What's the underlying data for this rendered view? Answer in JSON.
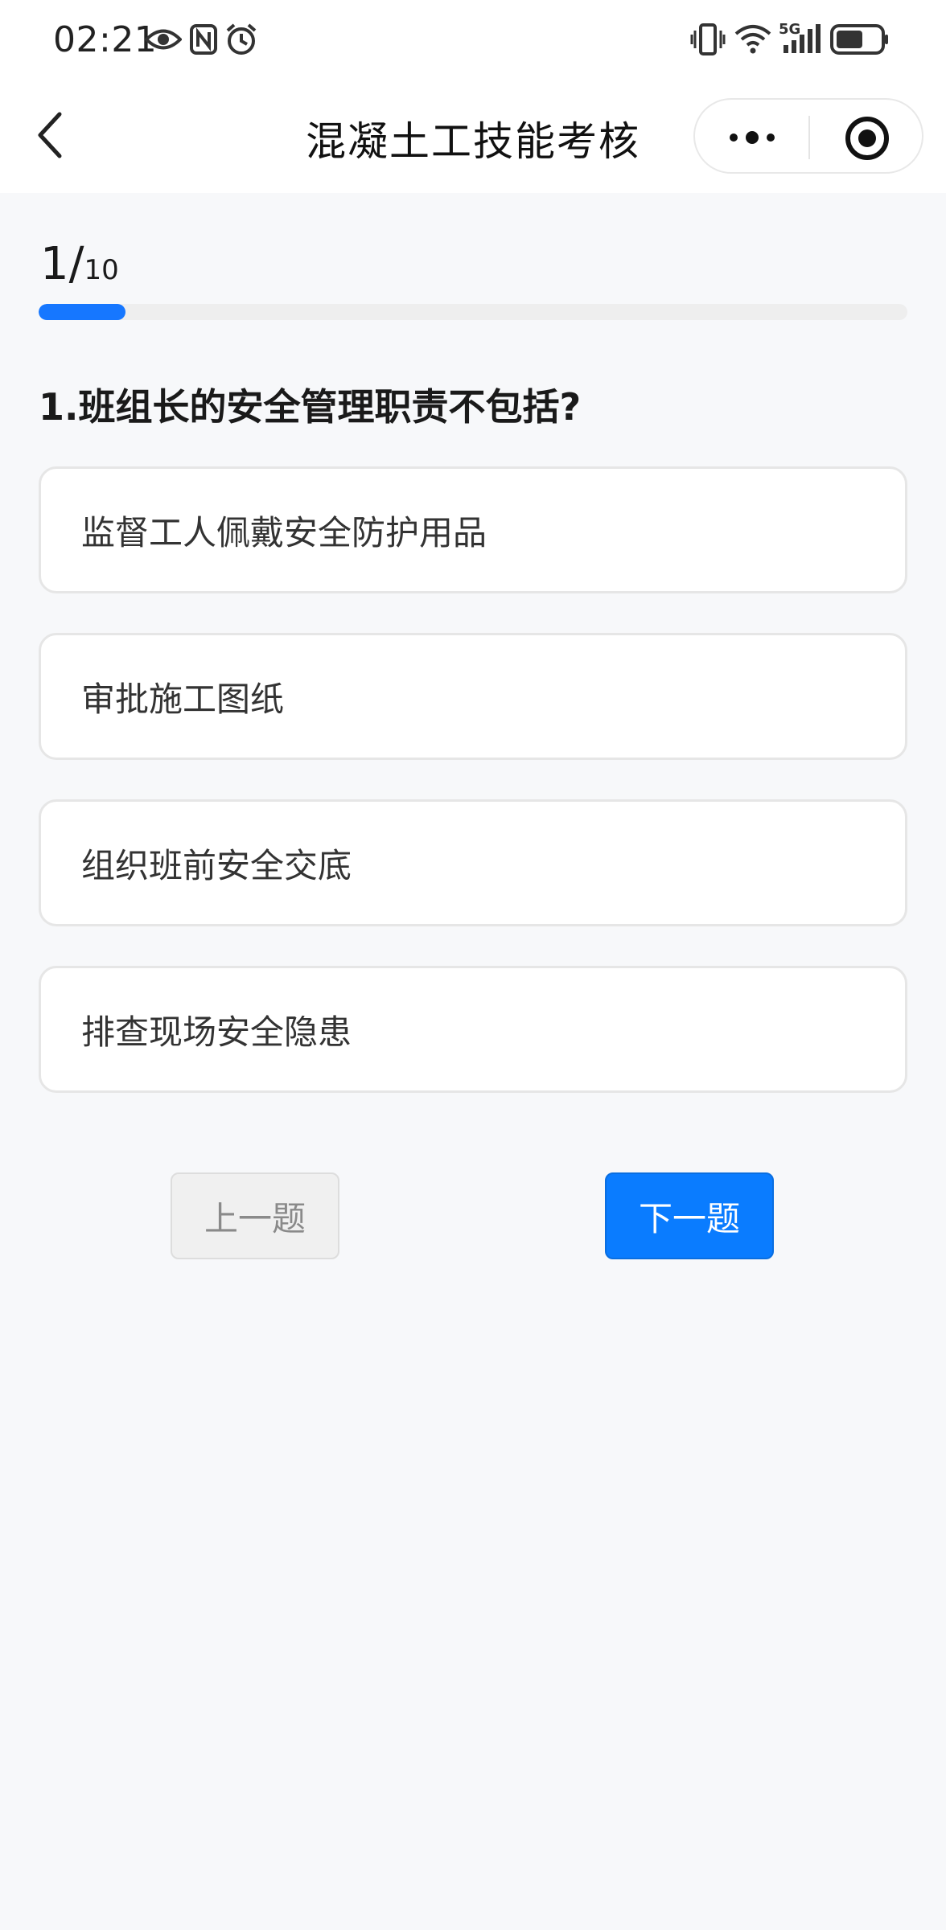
{
  "status_bar": {
    "time": "02:21",
    "network": "5G"
  },
  "nav": {
    "title": "混凝土工技能考核"
  },
  "progress": {
    "current": "1/",
    "total": "10",
    "fraction": 0.1
  },
  "question": {
    "text": "1.班组长的安全管理职责不包括?",
    "options": [
      "监督工人佩戴安全防护用品",
      "审批施工图纸",
      "组织班前安全交底",
      "排查现场安全隐患"
    ]
  },
  "buttons": {
    "prev_label": "上一题",
    "next_label": "下一题"
  },
  "colors": {
    "accent": "#1677ff",
    "background": "#f7f8fa"
  }
}
